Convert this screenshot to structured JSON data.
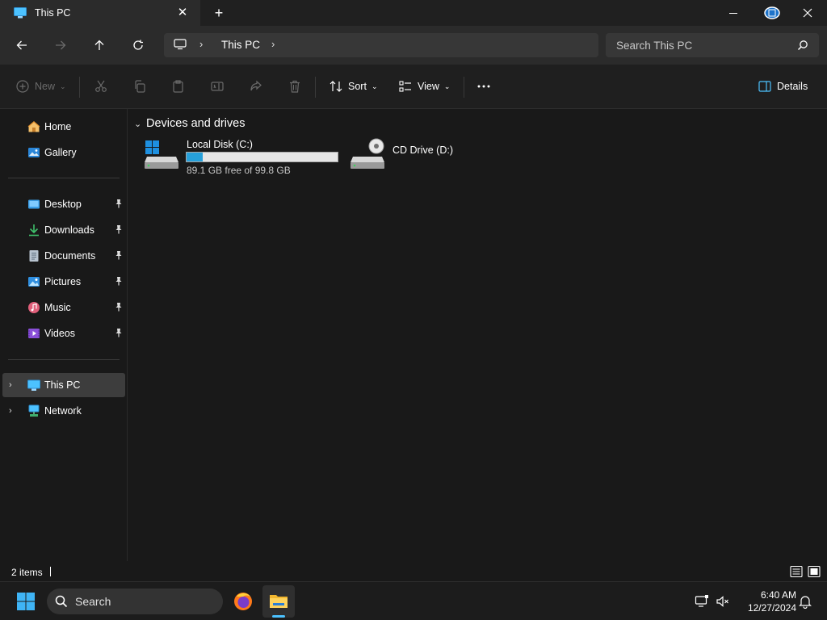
{
  "window": {
    "tab_title": "This PC",
    "tab_icon": "this-pc-icon",
    "buttons": [
      "minimize-icon",
      "maximize-icon",
      "close-icon"
    ]
  },
  "address_bar": {
    "breadcrumb": "This PC",
    "search_placeholder": "Search This PC"
  },
  "command_bar": {
    "new_label": "New",
    "sort_label": "Sort",
    "view_label": "View",
    "details_label": "Details"
  },
  "sidebar": {
    "top_items": [
      {
        "label": "Home",
        "icon": "home-icon"
      },
      {
        "label": "Gallery",
        "icon": "gallery-icon"
      }
    ],
    "quick_access": [
      {
        "label": "Desktop",
        "icon": "desktop-folder-icon",
        "pinned": true
      },
      {
        "label": "Downloads",
        "icon": "downloads-folder-icon",
        "pinned": true
      },
      {
        "label": "Documents",
        "icon": "documents-folder-icon",
        "pinned": true
      },
      {
        "label": "Pictures",
        "icon": "pictures-folder-icon",
        "pinned": true
      },
      {
        "label": "Music",
        "icon": "music-folder-icon",
        "pinned": true
      },
      {
        "label": "Videos",
        "icon": "videos-folder-icon",
        "pinned": true
      }
    ],
    "locations": [
      {
        "label": "This PC",
        "icon": "this-pc-icon",
        "selected": true
      },
      {
        "label": "Network",
        "icon": "network-icon",
        "selected": false
      }
    ]
  },
  "content": {
    "group_title": "Devices and drives",
    "drives": [
      {
        "name": "Local Disk (C:)",
        "free_text": "89.1 GB free of 99.8 GB",
        "used_fraction": 0.107,
        "icon": "local-disk-icon"
      },
      {
        "name": "CD Drive (D:)",
        "icon": "cd-drive-icon"
      }
    ]
  },
  "status_bar": {
    "item_count": "2 items"
  },
  "taskbar": {
    "search_label": "Search",
    "time": "6:40 AM",
    "date": "12/27/2024"
  },
  "colors": {
    "accent": "#26a0da",
    "background": "#191919",
    "selected": "#3d3d3d"
  }
}
